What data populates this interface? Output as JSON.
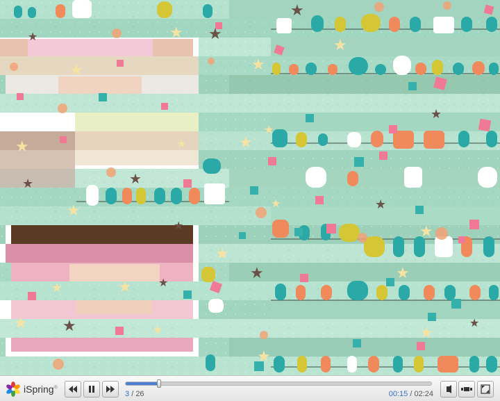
{
  "player": {
    "brand": "iSpring",
    "brand_mark": "®",
    "slide_current": "3",
    "slide_separator": "/",
    "slide_total": "26",
    "time_elapsed": "00:15",
    "time_separator": "/",
    "time_total": "02:24",
    "progress": 0.11,
    "accent_color": "#4a7fd1"
  },
  "icons": {
    "prev": "rewind-icon",
    "pause": "pause-icon",
    "next": "fast-forward-icon",
    "volume": "volume-icon",
    "layout": "layout-icon",
    "fullscreen": "fullscreen-icon"
  },
  "colors": {
    "background_mint": "#a9dbc6",
    "bird_teal": "#2aa9a6",
    "bird_orange": "#f08a5d",
    "bird_yellow": "#d4c634",
    "confetti_pink": "#f07a95",
    "confetti_teal": "#36b0aa"
  }
}
